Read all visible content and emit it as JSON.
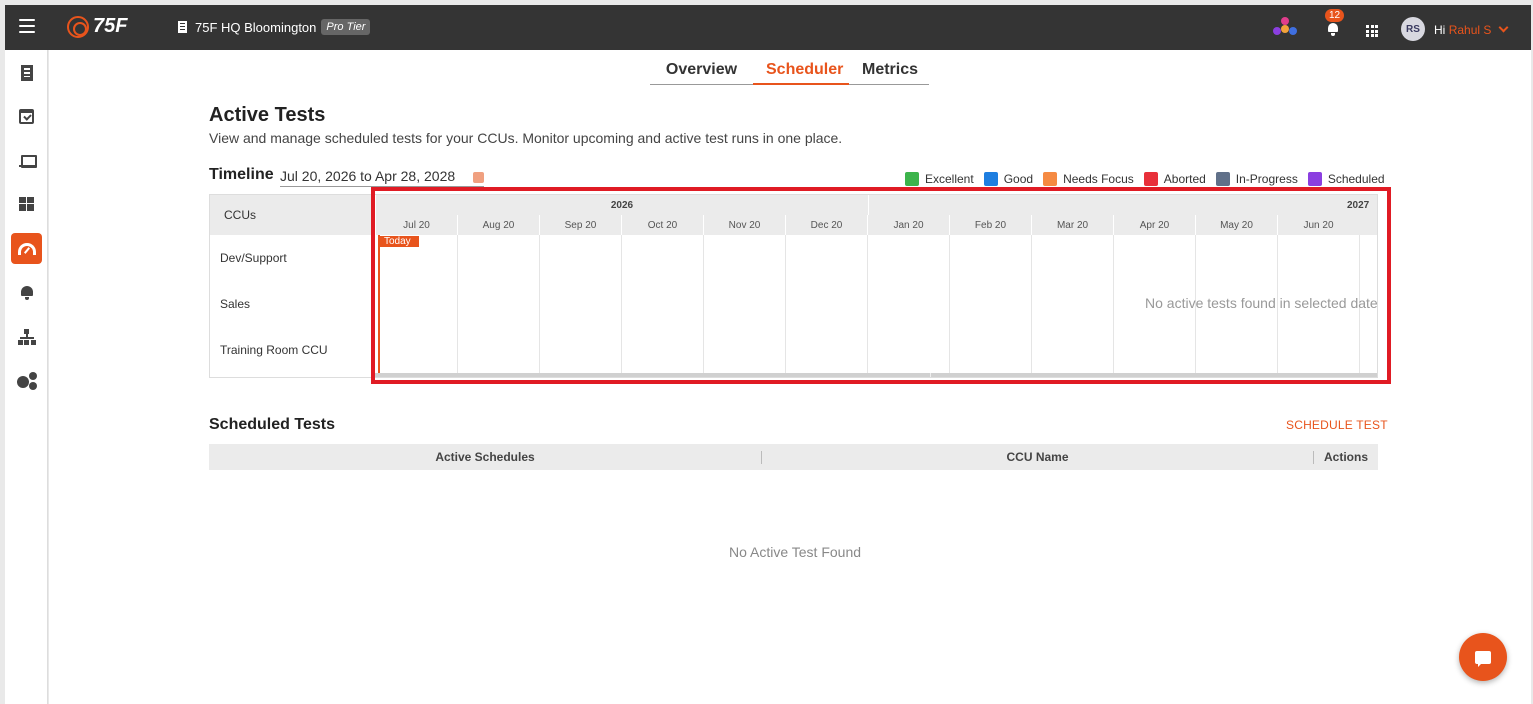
{
  "header": {
    "brand": "75F",
    "site_name": "75F HQ Bloomington",
    "tier": "Pro Tier",
    "notification_count": "12",
    "avatar_initials": "RS",
    "greeting": "Hi",
    "user_name": "Rahul S"
  },
  "sidebar": {
    "items": [
      {
        "icon": "building-icon",
        "active": false
      },
      {
        "icon": "calendar-check-icon",
        "active": false
      },
      {
        "icon": "laptop-icon",
        "active": false
      },
      {
        "icon": "dashboard-icon",
        "active": false
      },
      {
        "icon": "gauge-icon",
        "active": true
      },
      {
        "icon": "bell-icon",
        "active": false
      },
      {
        "icon": "hierarchy-icon",
        "active": false
      },
      {
        "icon": "gears-icon",
        "active": false
      }
    ]
  },
  "tabs": [
    {
      "label": "Overview",
      "active": false
    },
    {
      "label": "Scheduler",
      "active": true
    },
    {
      "label": "Metrics",
      "active": false
    }
  ],
  "page": {
    "title": "Active Tests",
    "subtitle": "View and manage scheduled tests for your CCUs. Monitor upcoming and active test runs in one place."
  },
  "timeline": {
    "label": "Timeline",
    "date_range": "Jul 20, 2026 to Apr 28, 2028",
    "legend": [
      {
        "label": "Excellent",
        "color": "#3cb44b"
      },
      {
        "label": "Good",
        "color": "#1e7ee0"
      },
      {
        "label": "Needs Focus",
        "color": "#f58a42"
      },
      {
        "label": "Aborted",
        "color": "#e8303a"
      },
      {
        "label": "In-Progress",
        "color": "#607089"
      },
      {
        "label": "Scheduled",
        "color": "#8b3fe0"
      }
    ],
    "ccu_header": "CCUs",
    "ccus": [
      "Dev/Support",
      "Sales",
      "Training Room CCU"
    ],
    "years": [
      "2026",
      "2027"
    ],
    "months": [
      "Jul 20",
      "Aug 20",
      "Sep 20",
      "Oct 20",
      "Nov 20",
      "Dec 20",
      "Jan 20",
      "Feb 20",
      "Mar 20",
      "Apr 20",
      "May 20",
      "Jun 20"
    ],
    "today_label": "Today",
    "empty_message": "No active tests found in selected date r"
  },
  "scheduled": {
    "title": "Scheduled Tests",
    "button": "SCHEDULE TEST",
    "columns": [
      "Active Schedules",
      "CCU Name",
      "Actions"
    ],
    "empty_message": "No Active Test Found"
  }
}
